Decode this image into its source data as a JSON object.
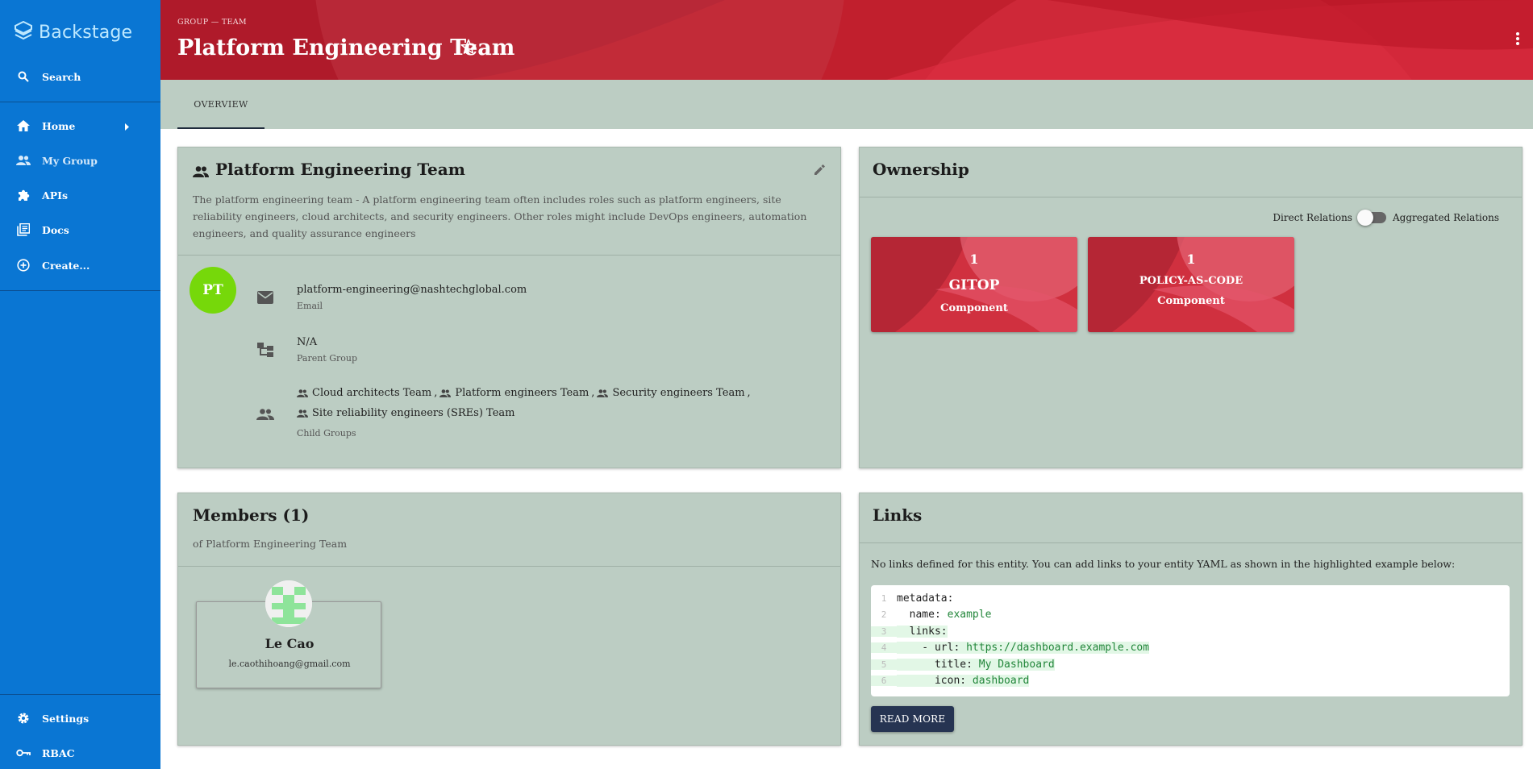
{
  "sidebar": {
    "brand": "Backstage",
    "search_label": "Search",
    "items": [
      {
        "label": "Home",
        "icon": "home-icon"
      },
      {
        "label": "My Group",
        "icon": "people-icon"
      },
      {
        "label": "APIs",
        "icon": "puzzle-icon"
      },
      {
        "label": "Docs",
        "icon": "library-icon"
      },
      {
        "label": "Create...",
        "icon": "add-circle-icon"
      }
    ],
    "bottom_items": [
      {
        "label": "Settings",
        "icon": "gear-icon"
      },
      {
        "label": "RBAC",
        "icon": "key-icon"
      }
    ]
  },
  "header": {
    "breadcrumb": "GROUP — TEAM",
    "title": "Platform Engineering Team",
    "accent": "#c41a2c"
  },
  "tabs": [
    {
      "label": "OVERVIEW",
      "active": true
    }
  ],
  "group_card": {
    "title": "Platform Engineering Team",
    "description": "The platform engineering team - A platform engineering team often includes roles such as platform engineers, site reliability engineers, cloud architects, and security engineers. Other roles might include DevOps engineers, automation engineers, and quality assurance engineers",
    "avatar_initials": "PT",
    "avatar_color": "#76d80a",
    "email": {
      "value": "platform-engineering@nashtechglobal.com",
      "label": "Email"
    },
    "parent": {
      "value": "N/A",
      "label": "Parent Group"
    },
    "children": {
      "items": [
        "Cloud architects Team",
        "Platform engineers Team",
        "Security engineers Team",
        "Site reliability engineers (SREs) Team"
      ],
      "label": "Child Groups"
    }
  },
  "ownership": {
    "title": "Ownership",
    "toggle_left": "Direct Relations",
    "toggle_right": "Aggregated Relations",
    "toggle_on": false,
    "cards": [
      {
        "count": "1",
        "name": "GITOP",
        "kind": "Component"
      },
      {
        "count": "1",
        "name": "POLICY-AS-CODE",
        "kind": "Component"
      }
    ]
  },
  "members": {
    "title": "Members (1)",
    "subtitle": "of Platform Engineering Team",
    "list": [
      {
        "name": "Le Cao",
        "email": "le.caothihoang@gmail.com"
      }
    ]
  },
  "links": {
    "title": "Links",
    "note": "No links defined for this entity. You can add links to your entity YAML as shown in the highlighted example below:",
    "code": [
      {
        "n": "1",
        "key": "metadata:",
        "val": "",
        "hl": false
      },
      {
        "n": "2",
        "key": "  name: ",
        "val": "example",
        "hl": false
      },
      {
        "n": "3",
        "key": "  links:",
        "val": "",
        "hl": true
      },
      {
        "n": "4",
        "key": "    - url: ",
        "val": "https://dashboard.example.com",
        "hl": true
      },
      {
        "n": "5",
        "key": "      title: ",
        "val": "My Dashboard",
        "hl": true
      },
      {
        "n": "6",
        "key": "      icon: ",
        "val": "dashboard",
        "hl": true
      }
    ],
    "read_more": "READ MORE"
  }
}
